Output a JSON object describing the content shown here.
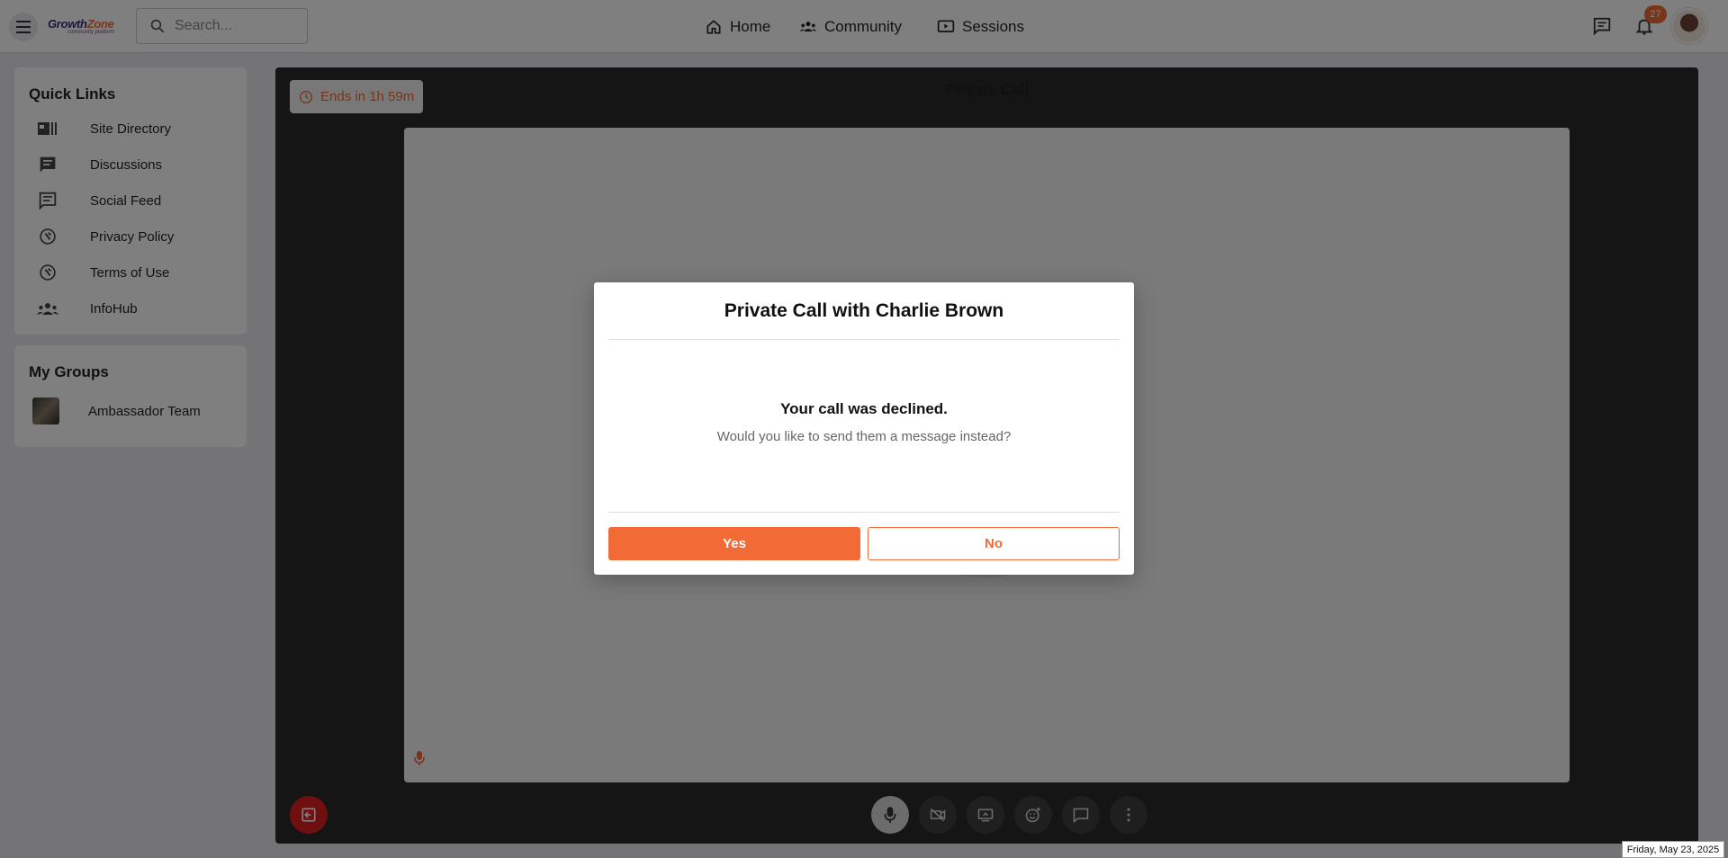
{
  "topbar": {
    "logo_main": "Growth",
    "logo_accent": "Zone",
    "logo_sub": "community platform",
    "search_placeholder": "Search...",
    "nav": [
      {
        "label": "Home",
        "icon": "home-icon"
      },
      {
        "label": "Community",
        "icon": "community-icon"
      },
      {
        "label": "Sessions",
        "icon": "sessions-icon"
      }
    ],
    "notification_count": "27"
  },
  "sidebar": {
    "quick_links_title": "Quick Links",
    "quick_links": [
      {
        "label": "Site Directory",
        "icon": "directory-icon"
      },
      {
        "label": "Discussions",
        "icon": "chat-icon"
      },
      {
        "label": "Social Feed",
        "icon": "feed-icon"
      },
      {
        "label": "Privacy Policy",
        "icon": "policy-icon"
      },
      {
        "label": "Terms of Use",
        "icon": "terms-icon"
      },
      {
        "label": "InfoHub",
        "icon": "people-icon"
      }
    ],
    "groups_title": "My Groups",
    "groups": [
      {
        "label": "Ambassador Team"
      }
    ]
  },
  "call": {
    "timer": "Ends in 1h 59m",
    "title": "Private Call"
  },
  "modal": {
    "title": "Private Call with Charlie Brown",
    "heading": "Your call was declined.",
    "text": "Would you like to send them a message instead?",
    "yes_label": "Yes",
    "no_label": "No"
  },
  "date_tooltip": "Friday, May 23, 2025",
  "colors": {
    "accent": "#f26b36",
    "leave": "#e01e1e"
  }
}
